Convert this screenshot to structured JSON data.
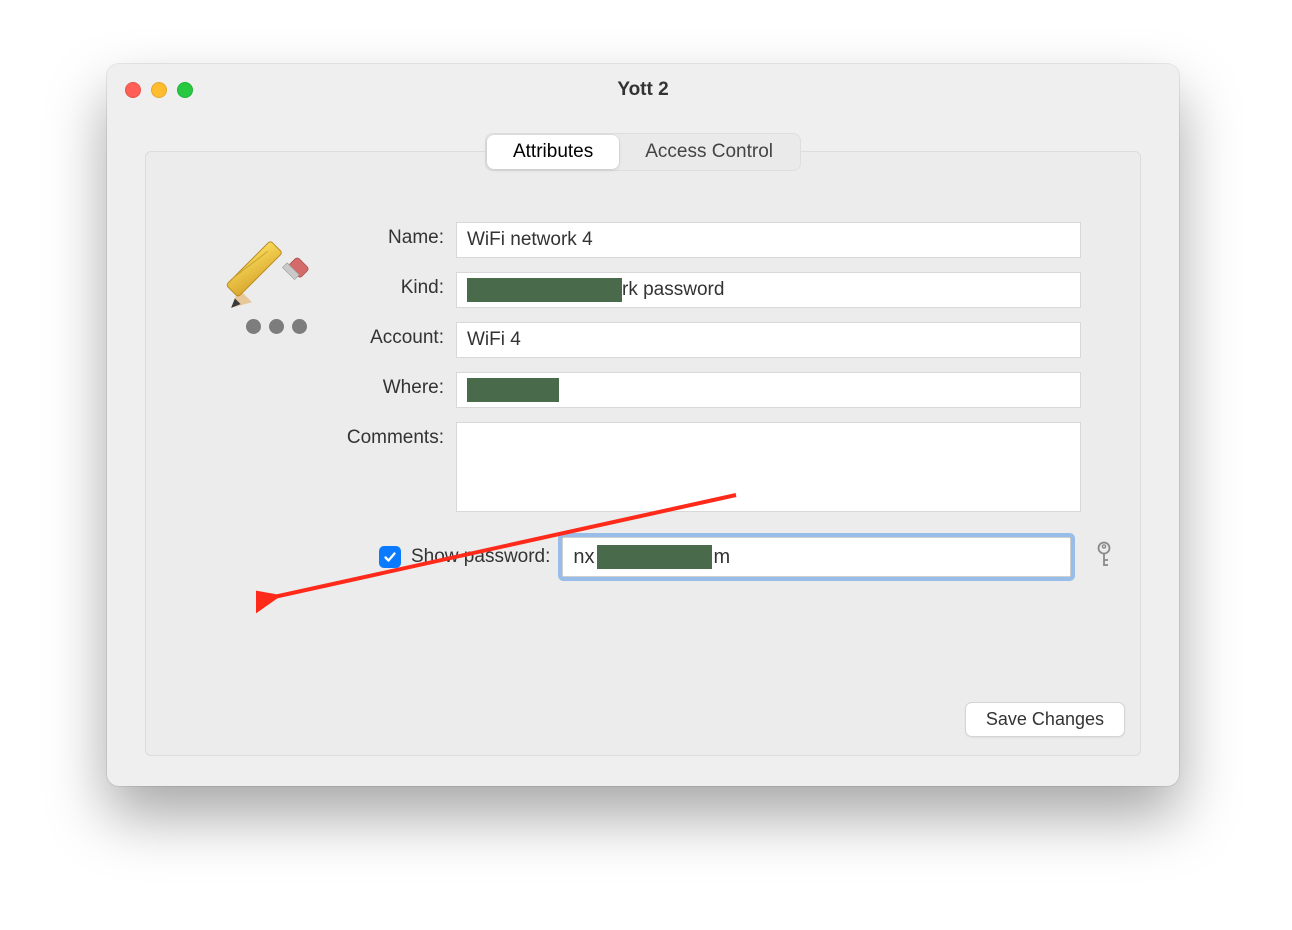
{
  "window": {
    "title": "Yott 2"
  },
  "tabs": {
    "attributes": "Attributes",
    "access_control": "Access Control"
  },
  "form": {
    "labels": {
      "name": "Name:",
      "kind": "Kind:",
      "account": "Account:",
      "where": "Where:",
      "comments": "Comments:",
      "show_password": "Show password:"
    },
    "values": {
      "name": "WiFi network 4",
      "kind_suffix": "rk password",
      "account": "WiFi 4",
      "where": "",
      "comments": "",
      "password_prefix": "nx",
      "password_suffix": "m"
    }
  },
  "buttons": {
    "save_changes": "Save Changes"
  }
}
